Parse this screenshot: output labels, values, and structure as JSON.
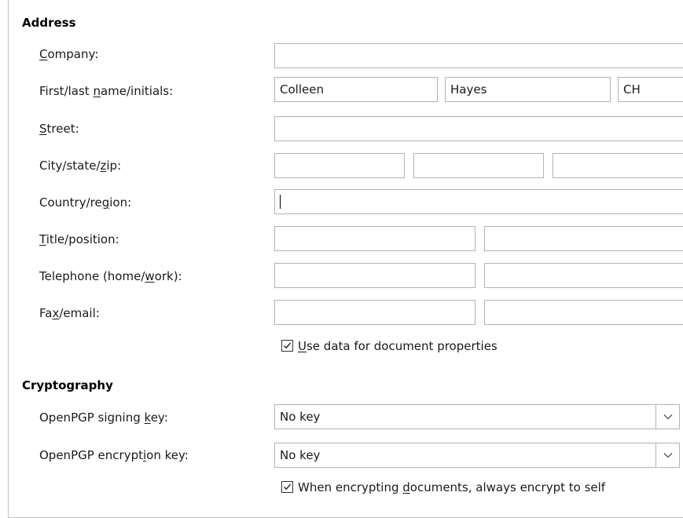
{
  "address": {
    "title": "Address",
    "company": {
      "label_pre": "",
      "label_u": "C",
      "label_post": "ompany:",
      "value": ""
    },
    "name": {
      "label_pre": "First/last ",
      "label_u": "n",
      "label_post": "ame/initials:",
      "first": "Colleen",
      "last": "Hayes",
      "initials": "CH"
    },
    "street": {
      "label_pre": "",
      "label_u": "S",
      "label_post": "treet:",
      "value": ""
    },
    "city": {
      "label_pre": "City/state/",
      "label_u": "z",
      "label_post": "ip:",
      "city": "",
      "state": "",
      "zip": ""
    },
    "country": {
      "label_pre": "Country/re",
      "label_u": "g",
      "label_post": "ion:",
      "value": ""
    },
    "title_pos": {
      "label_pre": "",
      "label_u": "T",
      "label_post": "itle/position:",
      "title": "",
      "position": ""
    },
    "telephone": {
      "label_pre": "Telephone (home/",
      "label_u": "w",
      "label_post": "ork):",
      "home": "",
      "work": ""
    },
    "fax": {
      "label_pre": "Fa",
      "label_u": "x",
      "label_post": "/email:",
      "fax": "",
      "email": ""
    },
    "use_data": {
      "label_pre": "",
      "label_u": "U",
      "label_post": "se data for document properties",
      "checked": true
    }
  },
  "cryptography": {
    "title": "Cryptography",
    "signing": {
      "label_pre": "OpenPGP signing ",
      "label_u": "k",
      "label_post": "ey:",
      "value": "No key"
    },
    "encryption": {
      "label_pre": "OpenPGP encrypt",
      "label_u": "i",
      "label_post": "on key:",
      "value": "No key"
    },
    "encrypt_self": {
      "label_pre": "When encrypting ",
      "label_u": "d",
      "label_post": "ocuments, always encrypt to self",
      "checked": true
    }
  },
  "icons": {
    "dropdown": "chevron-down-icon",
    "check": "checkmark-icon"
  }
}
